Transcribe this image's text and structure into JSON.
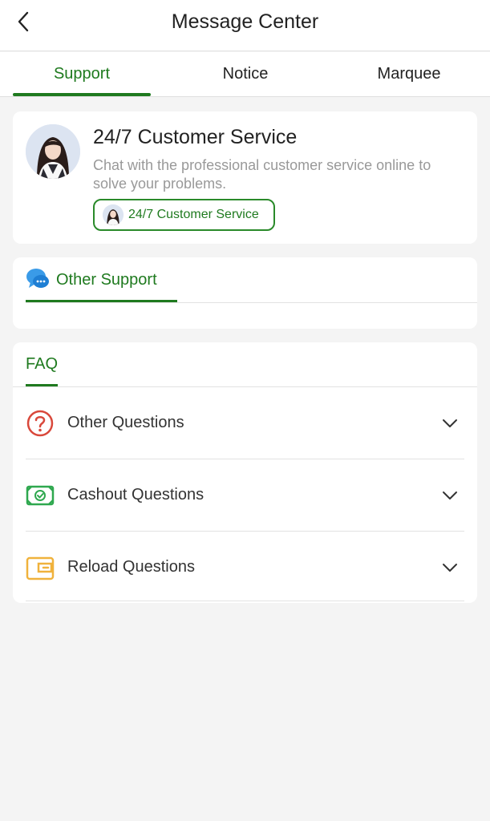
{
  "header": {
    "title": "Message Center"
  },
  "tabs": [
    {
      "label": "Support",
      "active": true
    },
    {
      "label": "Notice",
      "active": false
    },
    {
      "label": "Marquee",
      "active": false
    }
  ],
  "customer_service": {
    "title": "24/7 Customer Service",
    "description": "Chat with the professional customer service online to solve your problems.",
    "button_label": "24/7 Customer Service"
  },
  "other_support": {
    "label": "Other Support"
  },
  "faq": {
    "tab_label": "FAQ",
    "items": [
      {
        "label": "Other Questions",
        "icon": "question-icon"
      },
      {
        "label": "Cashout Questions",
        "icon": "cash-icon"
      },
      {
        "label": "Reload Questions",
        "icon": "wallet-icon"
      }
    ]
  },
  "colors": {
    "accent": "#1f7a1f",
    "background": "#f4f4f4",
    "question_icon": "#d9483b",
    "cash_icon": "#2fa84f",
    "wallet_icon": "#f0b23c"
  }
}
